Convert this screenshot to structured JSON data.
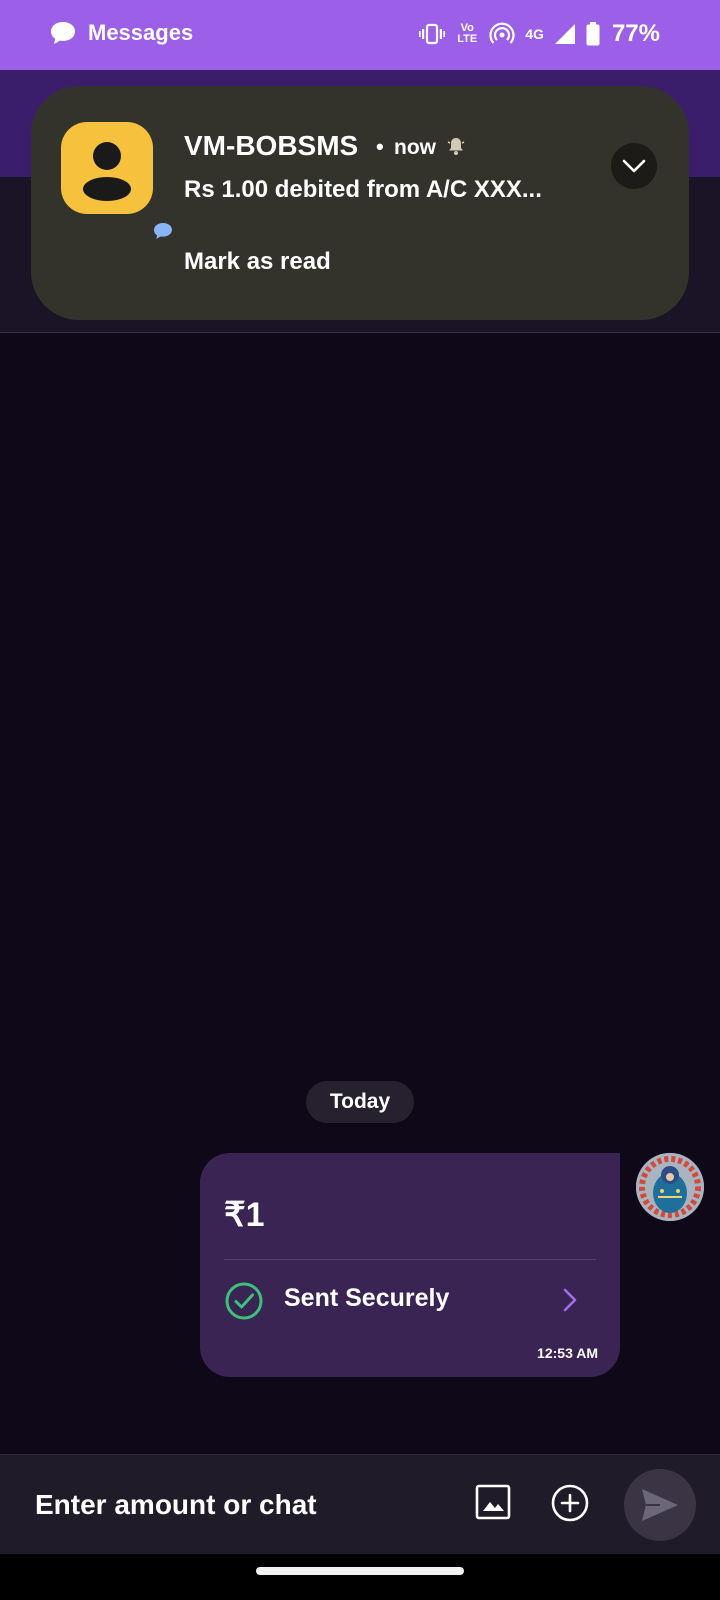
{
  "status_bar": {
    "app_icon": "message-bubble-icon",
    "app_name": "Messages",
    "volte_text": "Vo LTE",
    "network": "4G",
    "battery_percent": "77%"
  },
  "notification": {
    "sender": "VM-BOBSMS",
    "separator": "•",
    "time": "now",
    "body": "Rs 1.00 debited from A/C XXX...",
    "action": "Mark as read"
  },
  "conversation": {
    "date_label": "Today",
    "message": {
      "amount": "₹1",
      "status": "Sent Securely",
      "time": "12:53 AM"
    }
  },
  "composer": {
    "placeholder": "Enter amount or chat"
  },
  "colors": {
    "accent": "#9c5fe8",
    "header": "#3b1e6b",
    "bubble": "#3a2453",
    "success": "#3cc07a",
    "background": "#0e0818"
  }
}
